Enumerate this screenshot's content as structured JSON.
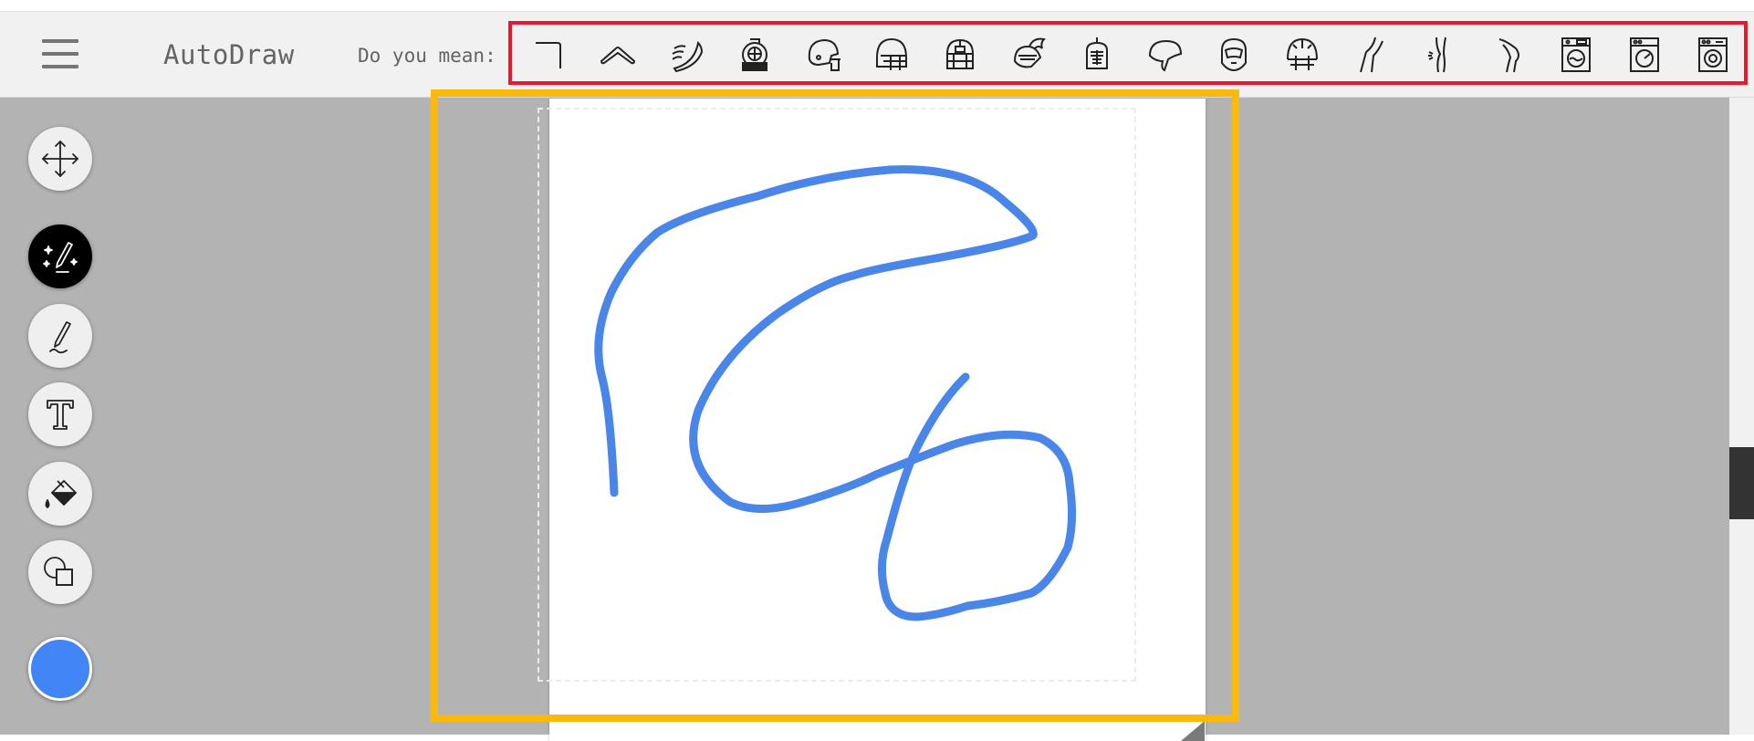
{
  "app": {
    "title": "AutoDraw"
  },
  "toolbar": {
    "menu_icon": "hamburger-menu-icon",
    "suggestion_label": "Do you mean:",
    "suggestions": [
      {
        "icon": "corner-line-icon"
      },
      {
        "icon": "boomerang-icon"
      },
      {
        "icon": "boomerang-motion-icon"
      },
      {
        "icon": "diving-helmet-icon"
      },
      {
        "icon": "football-helmet-icon"
      },
      {
        "icon": "football-helmet-front-icon"
      },
      {
        "icon": "catcher-helmet-icon"
      },
      {
        "icon": "knight-helmet-plume-icon"
      },
      {
        "icon": "knight-helmet-icon"
      },
      {
        "icon": "bike-helmet-icon"
      },
      {
        "icon": "motorcycle-helmet-icon"
      },
      {
        "icon": "football-helmet-grille-icon"
      },
      {
        "icon": "knee-icon"
      },
      {
        "icon": "knee-joint-pain-icon"
      },
      {
        "icon": "leg-icon"
      },
      {
        "icon": "washing-machine-icon"
      },
      {
        "icon": "washing-machine-dial-icon"
      },
      {
        "icon": "dryer-icon"
      }
    ]
  },
  "tools": [
    {
      "id": "move",
      "icon": "move-arrows-icon",
      "active": false
    },
    {
      "id": "autodraw",
      "icon": "autodraw-sparkle-pencil-icon",
      "active": true
    },
    {
      "id": "draw",
      "icon": "pencil-icon",
      "active": false
    },
    {
      "id": "type",
      "icon": "text-t-icon",
      "active": false
    },
    {
      "id": "fill",
      "icon": "paint-bucket-icon",
      "active": false
    },
    {
      "id": "shape",
      "icon": "shapes-icon",
      "active": false
    }
  ],
  "colors": {
    "current": "#4285f4",
    "stroke": "#4a86e8",
    "highlight_canvas": "#f9b90f",
    "highlight_suggestions": "#e8192c"
  }
}
